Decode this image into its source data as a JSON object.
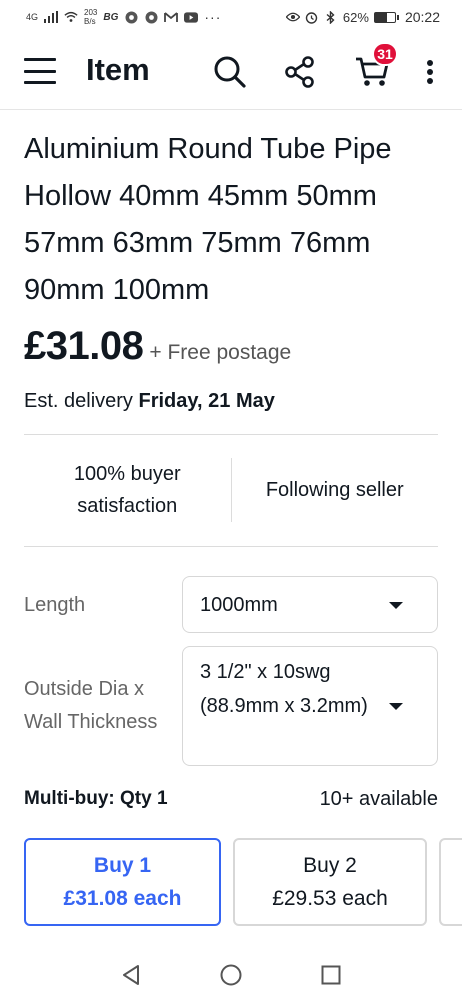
{
  "status_bar": {
    "network": "4G",
    "speed_value": "203",
    "speed_unit": "B/s",
    "carrier_tag": "BG",
    "more_indicator": "···",
    "battery_percent": "62%",
    "battery_level": 0.62,
    "time": "20:22"
  },
  "app_bar": {
    "title": "Item",
    "cart_count": "31",
    "icons": [
      "menu-icon",
      "search-icon",
      "share-icon",
      "cart-icon",
      "more-vert-icon"
    ]
  },
  "product": {
    "title": "Aluminium Round Tube Pipe Hollow 40mm 45mm 50mm 57mm 63mm 75mm 76mm 90mm 100mm",
    "price": "£31.08",
    "postage": "+ Free postage",
    "delivery_prefix": "Est. delivery",
    "delivery_date": "Friday, 21 May"
  },
  "seller": {
    "satisfaction": "100% buyer satisfaction",
    "following": "Following seller"
  },
  "options": {
    "length_label": "Length",
    "length_value": "1000mm",
    "dia_label": "Outside Dia x Wall Thickness",
    "dia_value": "3 1/2\" x 10swg (88.9mm x 3.2mm)"
  },
  "multibuy": {
    "label": "Multi-buy: Qty 1",
    "available": "10+ available",
    "tiers": [
      {
        "qty": "Buy 1",
        "price": "£31.08 each"
      },
      {
        "qty": "Buy 2",
        "price": "£29.53 each"
      }
    ]
  },
  "colors": {
    "accent": "#3665f3",
    "badge": "#e0103a",
    "text": "#111820"
  }
}
